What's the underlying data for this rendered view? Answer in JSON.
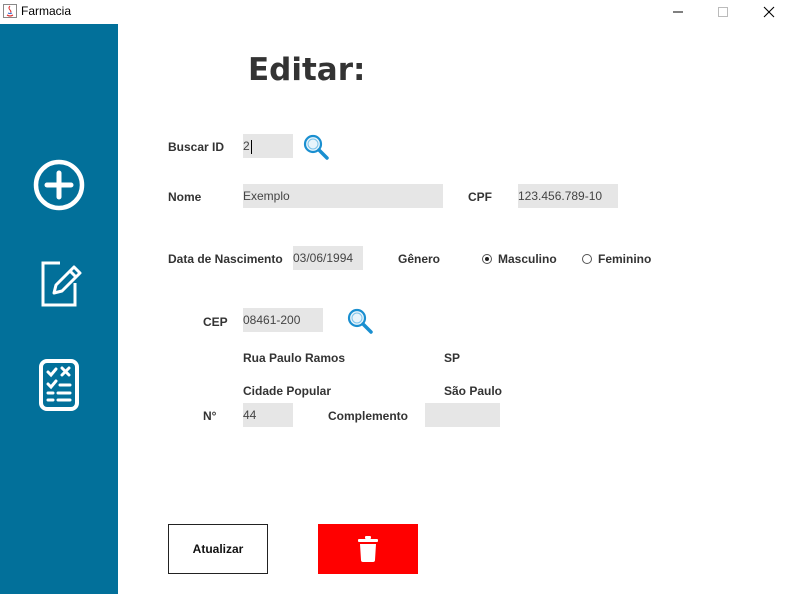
{
  "window": {
    "title": "Farmacia"
  },
  "sidebar": {
    "items": [
      {
        "icon": "add-circle-icon"
      },
      {
        "icon": "edit-icon"
      },
      {
        "icon": "checklist-icon"
      }
    ],
    "color": "#02709a"
  },
  "page": {
    "heading": "Editar:"
  },
  "form": {
    "buscar_id_label": "Buscar ID",
    "buscar_id_value": "2",
    "nome_label": "Nome",
    "nome_value": "Exemplo",
    "cpf_label": "CPF",
    "cpf_value": "123.456.789-10",
    "nascimento_label": "Data de Nascimento",
    "nascimento_value": "03/06/1994",
    "genero_label": "Gênero",
    "genero_options": [
      "Masculino",
      "Feminino"
    ],
    "genero_selected": "Masculino",
    "cep_label": "CEP",
    "cep_value": "08461-200",
    "rua": "Rua Paulo Ramos",
    "estado": "SP",
    "bairro": "Cidade Popular",
    "cidade": "São Paulo",
    "numero_label": "N°",
    "numero_value": "44",
    "complemento_label": "Complemento",
    "complemento_value": ""
  },
  "actions": {
    "update_label": "Atualizar",
    "delete_color": "#ff0000",
    "delete_icon": "trash-icon"
  }
}
